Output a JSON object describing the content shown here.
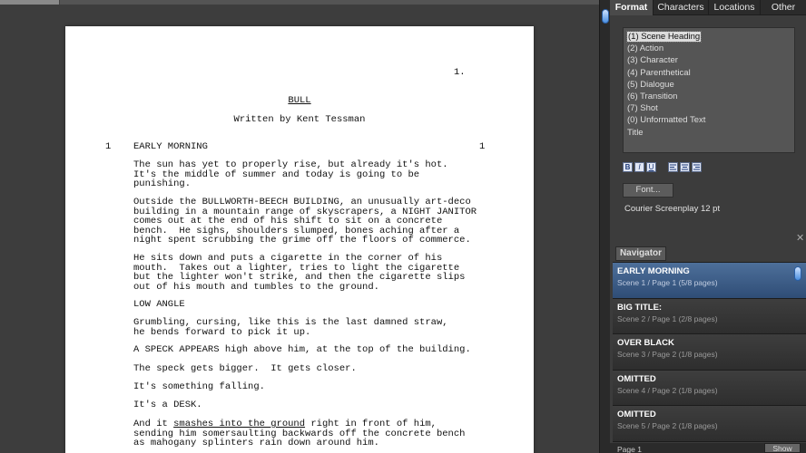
{
  "tab_strip": {
    "label": ""
  },
  "document": {
    "page_number": "1.",
    "title": "BULL",
    "byline": "Written by Kent Tessman",
    "scene_number": "1",
    "lines": [
      "EARLY MORNING",
      "The sun has yet to properly rise, but already it's hot.",
      "It's the middle of summer and today is going to be",
      "punishing.",
      "Outside the BULLWORTH-BEECH BUILDING, an unusually art-deco",
      "building in a mountain range of skyscrapers, a NIGHT JANITOR",
      "comes out at the end of his shift to sit on a concrete",
      "bench.  He sighs, shoulders slumped, bones aching after a",
      "night spent scrubbing the grime off the floors of commerce.",
      "He sits down and puts a cigarette in the corner of his",
      "mouth.  Takes out a lighter, tries to light the cigarette",
      "but the lighter won't strike, and then the cigarette slips",
      "out of his mouth and tumbles to the ground.",
      "LOW ANGLE",
      "Grumbling, cursing, like this is the last damned straw,",
      "he bends forward to pick it up.",
      "A SPECK APPEARS high above him, at the top of the building.",
      "The speck gets bigger.  It gets closer.",
      "It's something falling.",
      "It's a DESK.",
      "And it ",
      "smashes into the ground",
      " right in front of him,",
      "sending him somersaulting backwards off the concrete bench",
      "as mahogany splinters rain down around him."
    ]
  },
  "panel": {
    "tabs": [
      "Format",
      "Characters",
      "Locations",
      "Other"
    ],
    "active_tab": "Format",
    "formats": [
      "(1) Scene Heading",
      "(2) Action",
      "(3) Character",
      "(4) Parenthetical",
      "(5) Dialogue",
      "(6) Transition",
      "(7) Shot",
      "(0) Unformatted Text",
      "Title"
    ],
    "style_buttons": [
      "B",
      "I",
      "U"
    ],
    "align_icons": [
      "align-left-icon",
      "align-center-icon",
      "align-right-icon"
    ],
    "font_button": "Font...",
    "font_description": "Courier Screenplay 12 pt"
  },
  "navigator": {
    "header": "Navigator",
    "close_glyph": "✕",
    "items": [
      {
        "title": "EARLY MORNING",
        "sub": "Scene 1 / Page 1 (5/8 pages)"
      },
      {
        "title": "BIG TITLE:",
        "sub": "Scene 2 / Page 1 (2/8 pages)"
      },
      {
        "title": "OVER BLACK",
        "sub": "Scene 3 / Page 2 (1/8 pages)"
      },
      {
        "title": "OMITTED",
        "sub": "Scene 4 / Page 2 (1/8 pages)"
      },
      {
        "title": "OMITTED",
        "sub": "Scene 5 / Page 2 (1/8 pages)"
      }
    ],
    "footer_page": "Page 1",
    "show_button": "Show"
  }
}
